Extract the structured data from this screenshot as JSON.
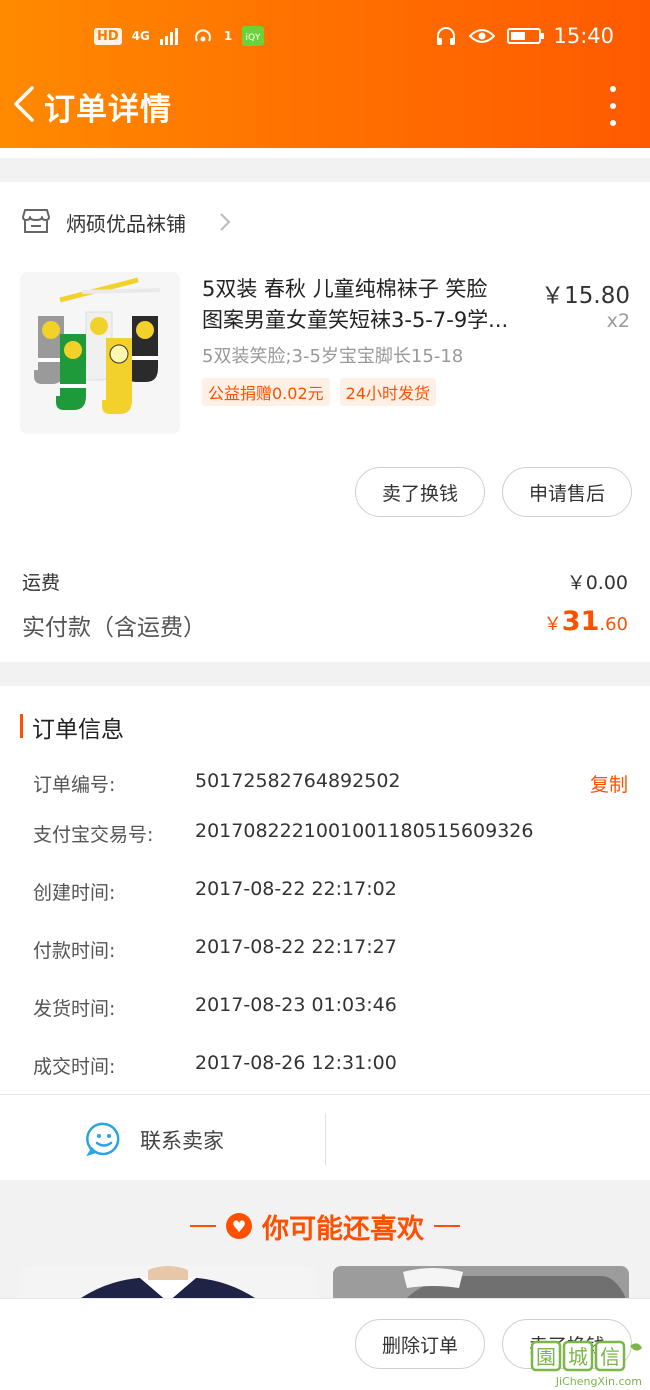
{
  "statusbar": {
    "hd": "HD",
    "net": "4G",
    "sim": "1",
    "time": "15:40"
  },
  "header": {
    "title": "订单详情"
  },
  "store": {
    "name": "炳硕优品袜铺"
  },
  "product": {
    "title_line1": "5双装 春秋 儿童纯棉袜子 笑脸",
    "title_line2": "图案男童女童笑短袜3-5-7-9学...",
    "price": "￥15.80",
    "qty": "x2",
    "sku": "5双装笑脸;3-5岁宝宝脚长15-18",
    "tags": [
      "公益捐赠0.02元",
      "24小时发货"
    ]
  },
  "item_actions": {
    "sell": "卖了换钱",
    "after_sale": "申请售后"
  },
  "fees": {
    "shipping_label": "运费",
    "shipping_value": "￥0.00",
    "total_label": "实付款（含运费）",
    "total_currency": "￥",
    "total_int": "31",
    "total_dec": ".60"
  },
  "order_info": {
    "title": "订单信息",
    "copy": "复制",
    "rows": [
      {
        "k": "订单编号:",
        "v": "50172582764892502"
      },
      {
        "k": "支付宝交易号:",
        "v": "2017082221001001180515609326"
      },
      {
        "k": "创建时间:",
        "v": "2017-08-22 22:17:02"
      },
      {
        "k": "付款时间:",
        "v": "2017-08-22 22:17:27"
      },
      {
        "k": "发货时间:",
        "v": "2017-08-23 01:03:46"
      },
      {
        "k": "成交时间:",
        "v": "2017-08-26 12:31:00"
      }
    ],
    "contact": "联系卖家"
  },
  "recommend": {
    "title": "你可能还喜欢"
  },
  "bottom": {
    "delete": "删除订单",
    "sell": "卖了换钱"
  },
  "watermark": {
    "text": "JiChengXin.com"
  },
  "colors": {
    "accent": "#ff5000",
    "header_start": "#ff8a00",
    "header_end": "#ff5a00"
  }
}
